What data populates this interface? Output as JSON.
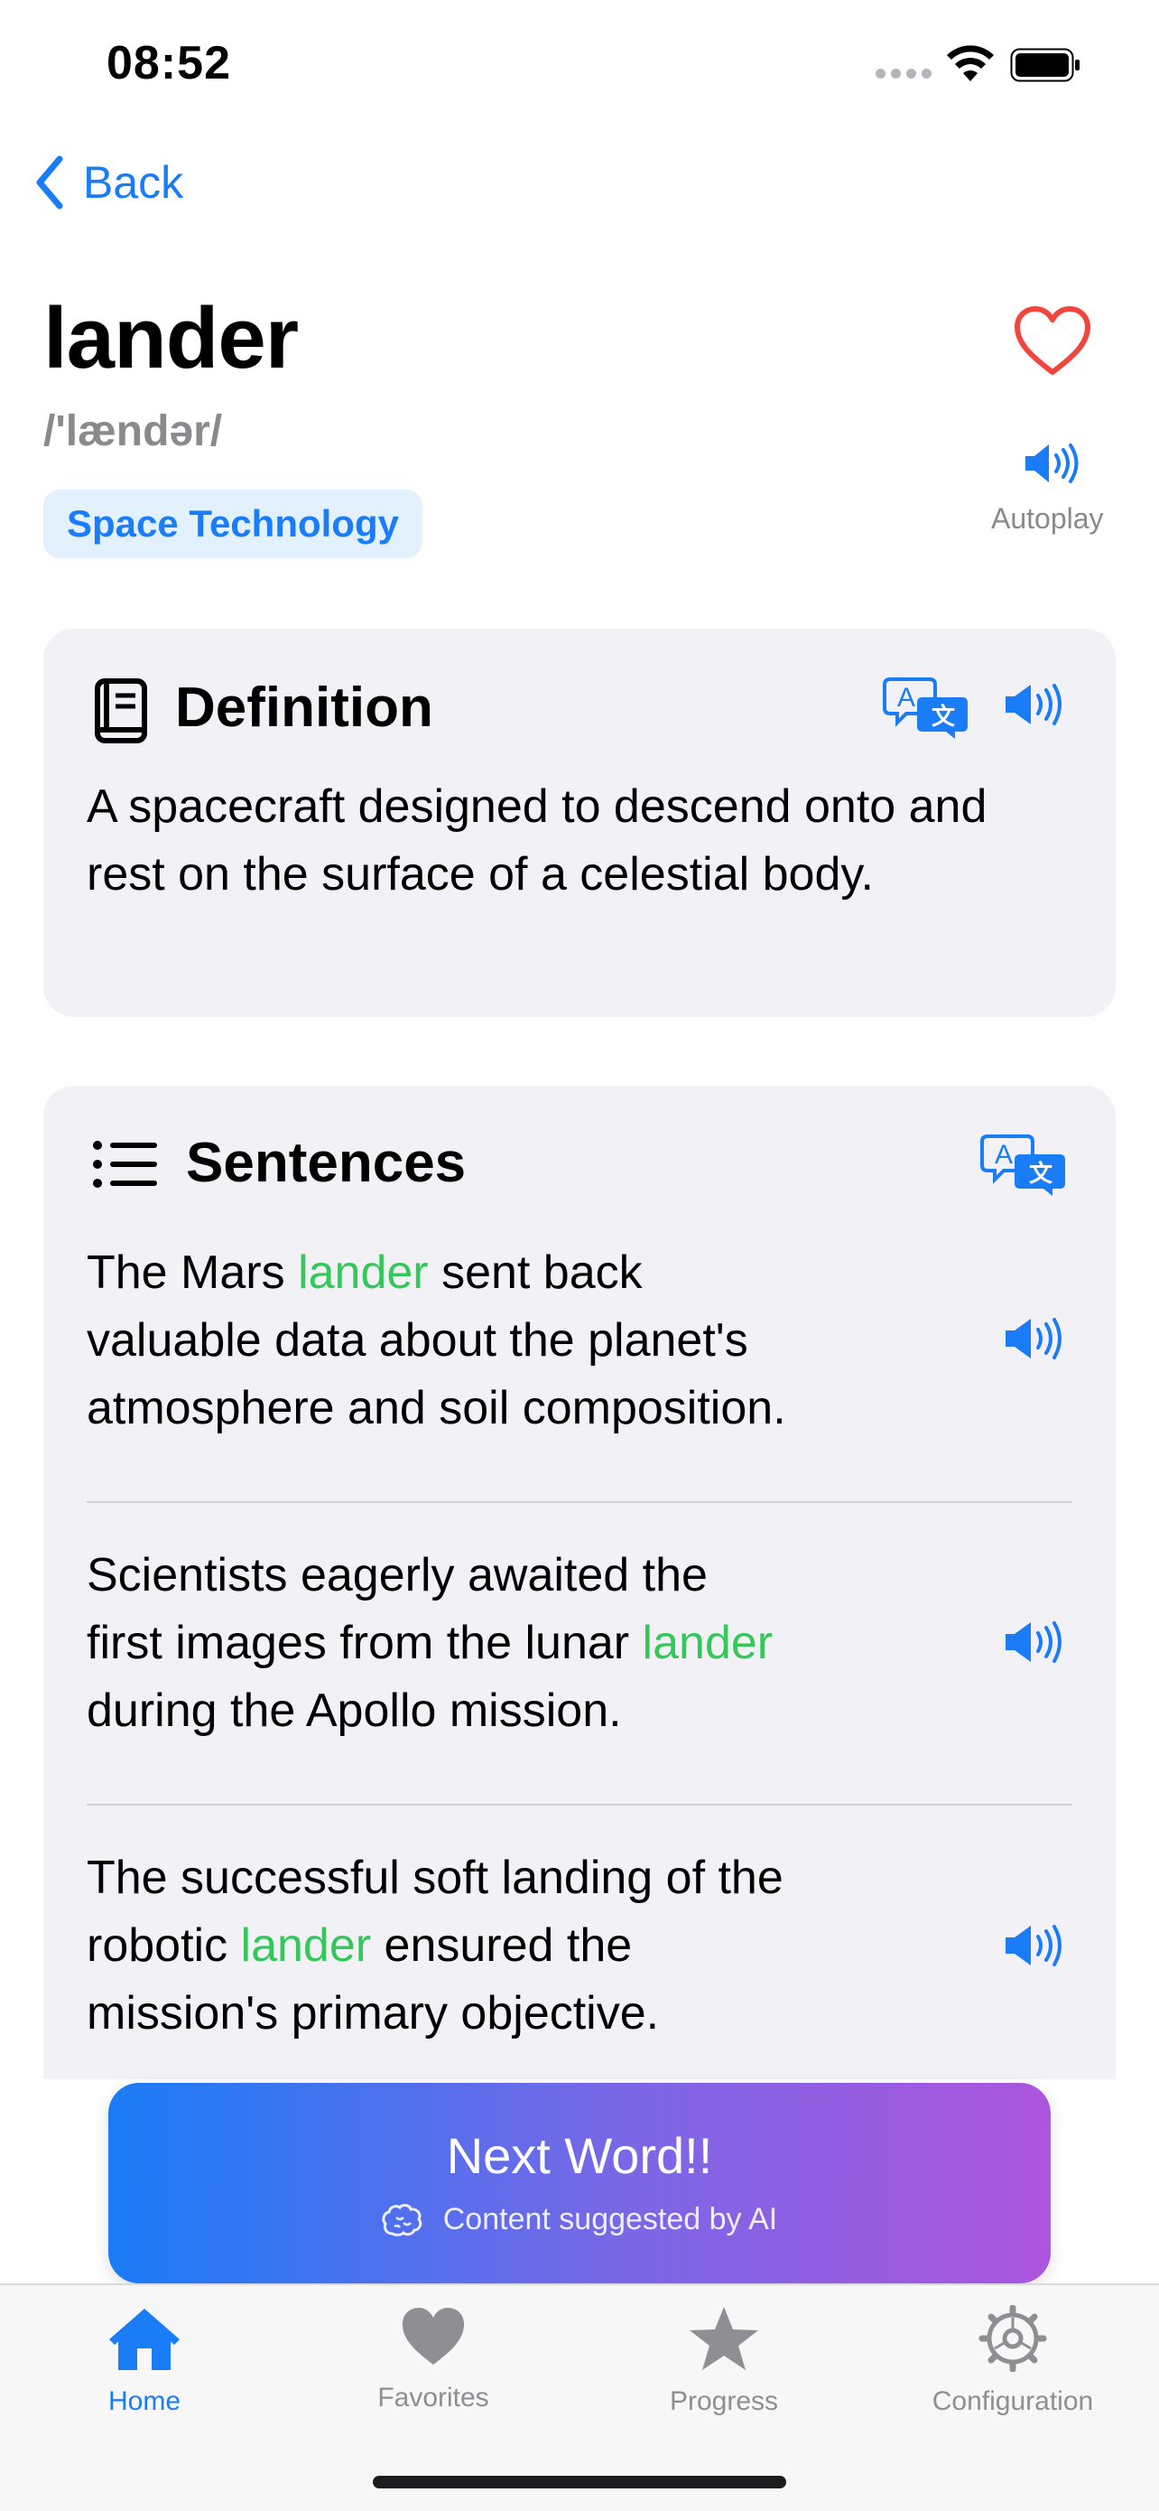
{
  "status_bar": {
    "time": "08:52"
  },
  "nav": {
    "back_label": "Back"
  },
  "word": {
    "term": "lander",
    "ipa": "/'lændər/",
    "category": "Space Technology",
    "autoplay_label": "Autoplay",
    "favorite_color": "#f2453d"
  },
  "definition": {
    "title": "Definition",
    "text": "A spacecraft designed to descend onto and rest on the surface of a celestial body."
  },
  "sentences": {
    "title": "Sentences",
    "highlight_color": "#34c759",
    "items": [
      {
        "l1a": "The Mars ",
        "l1h": "lander",
        "l1b": " sent back",
        "l2": "valuable data about the planet's",
        "l3": "atmosphere and soil composition."
      },
      {
        "l1": "Scientists eagerly awaited the",
        "l2a": "first images from the lunar ",
        "l2h": "lander",
        "l3": "during the Apollo mission."
      },
      {
        "l1": "The successful soft landing of the",
        "l2a": "robotic ",
        "l2h": "lander",
        "l2b": " ensured the",
        "l3": "mission's primary objective."
      }
    ]
  },
  "next_button": {
    "label": "Next Word!!",
    "ai_note": "Content suggested by AI"
  },
  "tabbar": {
    "items": [
      {
        "label": "Home",
        "icon": "house-icon",
        "active": true
      },
      {
        "label": "Favorites",
        "icon": "heart-icon"
      },
      {
        "label": "Progress",
        "icon": "star-icon"
      },
      {
        "label": "Configuration",
        "icon": "gear-icon"
      }
    ]
  },
  "colors": {
    "accent": "#1a7cf6",
    "card_bg": "#f1f1f6"
  }
}
